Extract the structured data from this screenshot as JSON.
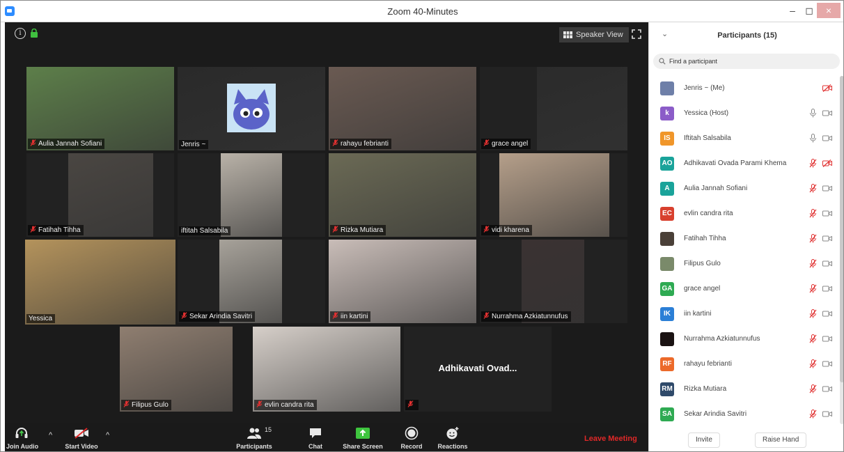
{
  "window": {
    "title": "Zoom 40-Minutes",
    "min_glyph": "–",
    "max_glyph": "◻",
    "close_glyph": "×"
  },
  "meeting": {
    "speaker_view_label": "Speaker View",
    "tiles": [
      {
        "name": "Aulia Jannah Sofiani",
        "mic_off": true,
        "bg": "#5d7f4a"
      },
      {
        "name": "Jenris ~",
        "mic_off": false,
        "bg": "#2a2a2a",
        "avatar": true
      },
      {
        "name": "rahayu febrianti",
        "mic_off": true,
        "bg": "#6a5a52"
      },
      {
        "name": "grace angel",
        "mic_off": true,
        "bg": "#2b2b2b"
      },
      {
        "name": "Fatihah Tihha",
        "mic_off": true,
        "bg": "#4a4642"
      },
      {
        "name": "iftitah Salsabila",
        "mic_off": false,
        "bg": "#b9b2a8"
      },
      {
        "name": "Rizka Mutiara",
        "mic_off": true,
        "bg": "#6b6a55"
      },
      {
        "name": "vidi kharena",
        "mic_off": true,
        "bg": "#b59f8a"
      },
      {
        "name": "Yessica",
        "mic_off": false,
        "bg": "#b4935c",
        "active": true
      },
      {
        "name": "Sekar Arindia Savitri",
        "mic_off": true,
        "bg": "#a7a29a"
      },
      {
        "name": "iin kartini",
        "mic_off": true,
        "bg": "#c9bdb8"
      },
      {
        "name": "Nurrahma Azkiatunnufus",
        "mic_off": true,
        "bg": "#3a3232"
      },
      {
        "name": "Filipus Gulo",
        "mic_off": true,
        "bg": "#8f7e70"
      },
      {
        "name": "evlin candra rita",
        "mic_off": true,
        "bg": "#d6cfc9"
      },
      {
        "name": "",
        "mic_off": true,
        "bg": "#262626",
        "name_only": "Adhikavati Ovad..."
      }
    ]
  },
  "toolbar": {
    "join_audio": "Join Audio",
    "start_video": "Start Video",
    "participants": "Participants",
    "participants_count": "15",
    "chat": "Chat",
    "share_screen": "Share Screen",
    "record": "Record",
    "reactions": "Reactions",
    "leave": "Leave Meeting"
  },
  "panel": {
    "title": "Participants (15)",
    "search_placeholder": "Find a participant",
    "invite": "Invite",
    "raise_hand": "Raise Hand",
    "participants": [
      {
        "name": "Jenris ~ (Me)",
        "avatar": "",
        "avatar_color": "#6e7fa8",
        "mic": "none",
        "cam": "off"
      },
      {
        "name": "Yessica (Host)",
        "avatar": "k",
        "avatar_color": "#8b5cc8",
        "mic": "on",
        "cam": "on"
      },
      {
        "name": "Iftitah Salsabila",
        "avatar": "IS",
        "avatar_color": "#f0962a",
        "mic": "on",
        "cam": "on"
      },
      {
        "name": "Adhikavati Ovada Parami Khema",
        "avatar": "AO",
        "avatar_color": "#1aa39a",
        "mic": "off",
        "cam": "off"
      },
      {
        "name": "Aulia Jannah Sofiani",
        "avatar": "A",
        "avatar_color": "#1aa39a",
        "mic": "off",
        "cam": "on"
      },
      {
        "name": "evlin candra rita",
        "avatar": "EC",
        "avatar_color": "#d8402e",
        "mic": "off",
        "cam": "on"
      },
      {
        "name": "Fatihah Tihha",
        "avatar": "",
        "avatar_color": "#4a4038",
        "mic": "off",
        "cam": "on"
      },
      {
        "name": "Filipus Gulo",
        "avatar": "",
        "avatar_color": "#7a8a6a",
        "mic": "off",
        "cam": "on"
      },
      {
        "name": "grace angel",
        "avatar": "GA",
        "avatar_color": "#2eaa52",
        "mic": "off",
        "cam": "on"
      },
      {
        "name": "iin kartini",
        "avatar": "IK",
        "avatar_color": "#2b7fd6",
        "mic": "off",
        "cam": "on"
      },
      {
        "name": "Nurrahma Azkiatunnufus",
        "avatar": "",
        "avatar_color": "#1a1212",
        "mic": "off",
        "cam": "on"
      },
      {
        "name": "rahayu febrianti",
        "avatar": "RF",
        "avatar_color": "#ec6a2a",
        "mic": "off",
        "cam": "on"
      },
      {
        "name": "Rizka Mutiara",
        "avatar": "RM",
        "avatar_color": "#2f4a6a",
        "mic": "off",
        "cam": "on"
      },
      {
        "name": "Sekar Arindia Savitri",
        "avatar": "SA",
        "avatar_color": "#2eaa52",
        "mic": "off",
        "cam": "on"
      }
    ]
  }
}
